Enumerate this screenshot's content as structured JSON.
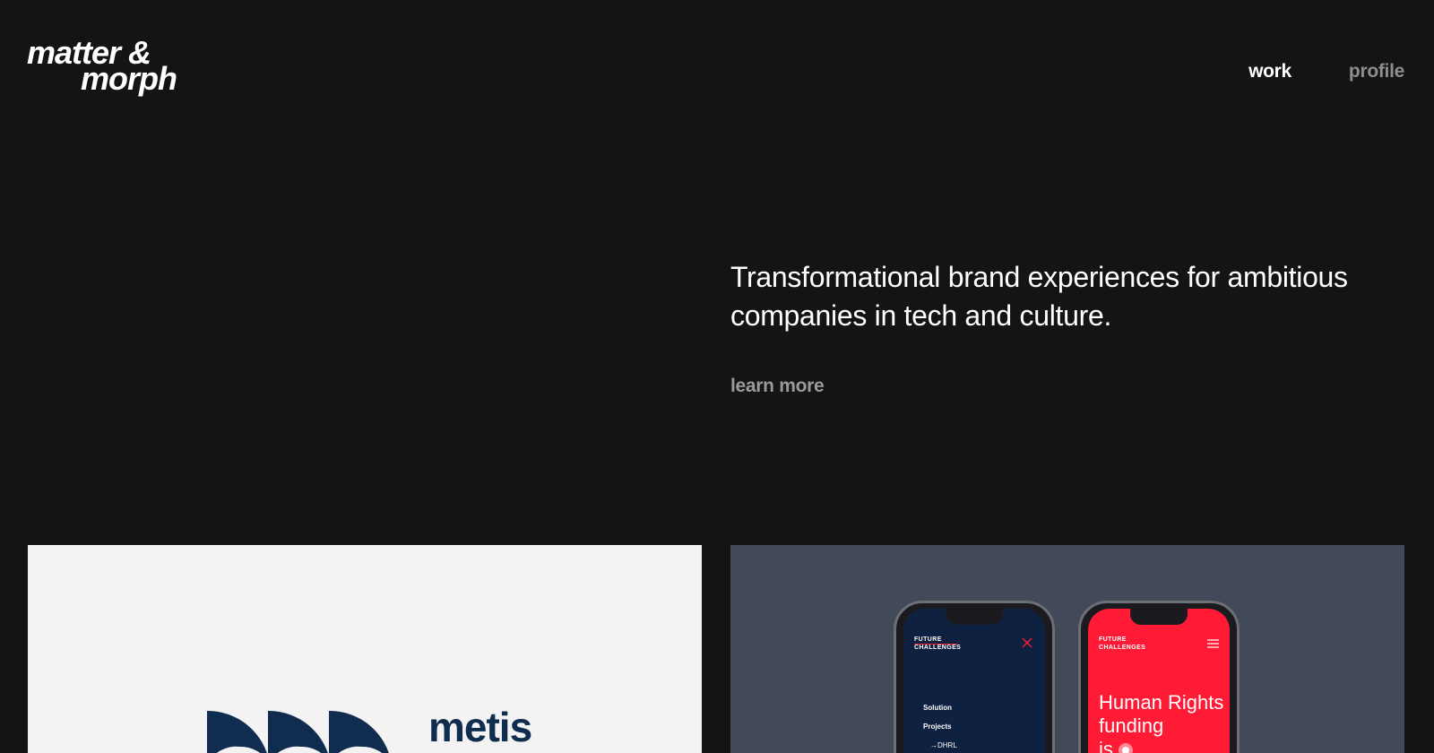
{
  "header": {
    "logo_line1": "matter &",
    "logo_line2": "morph",
    "nav": [
      {
        "label": "work",
        "active": true
      },
      {
        "label": "profile",
        "active": false
      }
    ]
  },
  "hero": {
    "tagline": "Transformational brand experiences for ambitious companies in tech and culture.",
    "cta": "learn more"
  },
  "projects": [
    {
      "brand_word": "metis",
      "background": "#f3f3f3",
      "brand_color": "#102d4f"
    },
    {
      "background": "#424958",
      "phone_one": {
        "brand_line1": "FUTURE",
        "brand_line2": "CHALLENGES",
        "menu": [
          "Solution",
          "Projects",
          "→DHRL"
        ]
      },
      "phone_two": {
        "brand_line1": "FUTURE",
        "brand_line2": "CHALLENGES",
        "headline_line1": "Human Rights",
        "headline_line2": "funding",
        "headline_line3": "is"
      }
    }
  ],
  "colors": {
    "page_bg": "#141414",
    "nav_active": "#ffffff",
    "nav_inactive": "#8e8e8e",
    "accent_red": "#ff1a35",
    "navy": "#0f2140"
  }
}
